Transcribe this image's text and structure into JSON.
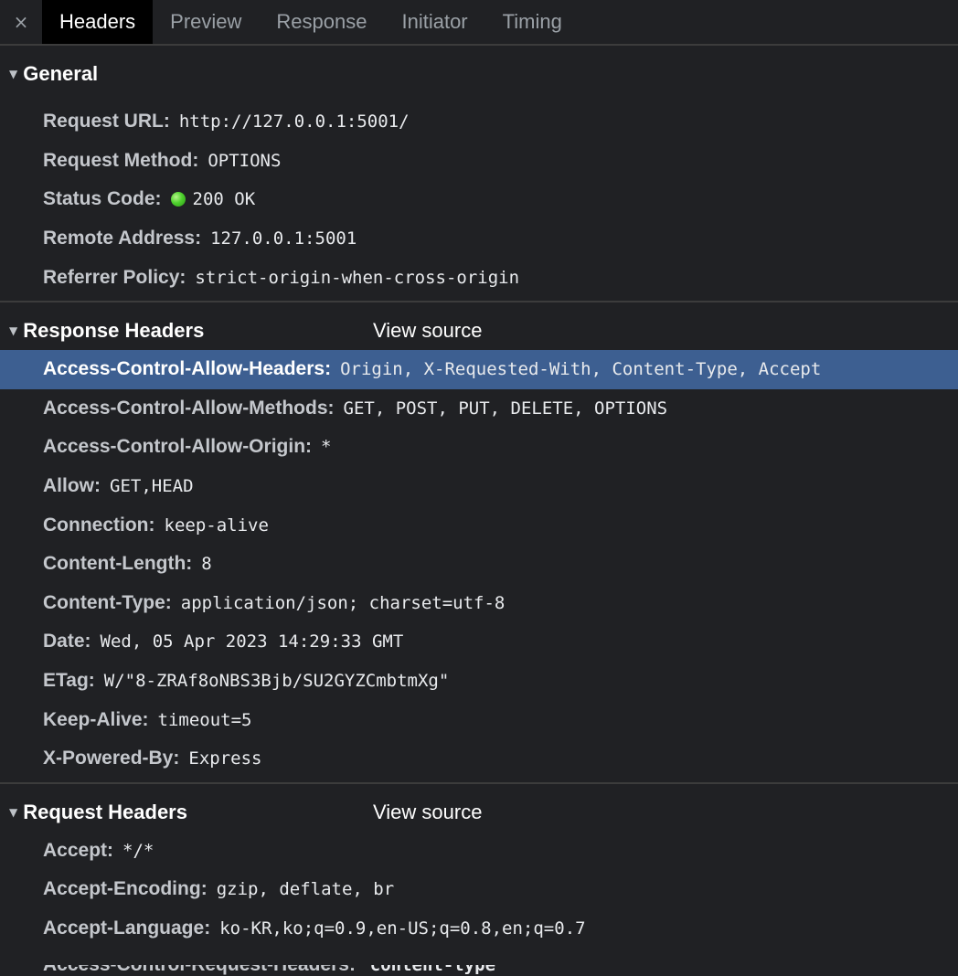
{
  "tabs": {
    "close_glyph": "×",
    "items": [
      "Headers",
      "Preview",
      "Response",
      "Initiator",
      "Timing"
    ],
    "active": "Headers"
  },
  "general": {
    "title": "General",
    "rows": [
      {
        "name": "Request URL",
        "value": "http://127.0.0.1:5001/"
      },
      {
        "name": "Request Method",
        "value": "OPTIONS"
      },
      {
        "name": "Status Code",
        "value": "200 OK",
        "status_color": "#4fd12e"
      },
      {
        "name": "Remote Address",
        "value": "127.0.0.1:5001"
      },
      {
        "name": "Referrer Policy",
        "value": "strict-origin-when-cross-origin"
      }
    ]
  },
  "response_headers": {
    "title": "Response Headers",
    "view_source": "View source",
    "rows": [
      {
        "name": "Access-Control-Allow-Headers",
        "value": "Origin, X-Requested-With, Content-Type, Accept",
        "selected": true
      },
      {
        "name": "Access-Control-Allow-Methods",
        "value": "GET, POST, PUT, DELETE, OPTIONS"
      },
      {
        "name": "Access-Control-Allow-Origin",
        "value": "*"
      },
      {
        "name": "Allow",
        "value": "GET,HEAD"
      },
      {
        "name": "Connection",
        "value": "keep-alive"
      },
      {
        "name": "Content-Length",
        "value": "8"
      },
      {
        "name": "Content-Type",
        "value": "application/json; charset=utf-8"
      },
      {
        "name": "Date",
        "value": "Wed, 05 Apr 2023 14:29:33 GMT"
      },
      {
        "name": "ETag",
        "value": "W/\"8-ZRAf8oNBS3Bjb/SU2GYZCmbtmXg\""
      },
      {
        "name": "Keep-Alive",
        "value": "timeout=5"
      },
      {
        "name": "X-Powered-By",
        "value": "Express"
      }
    ]
  },
  "request_headers": {
    "title": "Request Headers",
    "view_source": "View source",
    "rows": [
      {
        "name": "Accept",
        "value": "*/*"
      },
      {
        "name": "Accept-Encoding",
        "value": "gzip, deflate, br"
      },
      {
        "name": "Accept-Language",
        "value": "ko-KR,ko;q=0.9,en-US;q=0.8,en;q=0.7"
      }
    ],
    "cutoff_row": {
      "name": "Access-Control-Request-Headers",
      "value": "content-type"
    }
  },
  "colors": {
    "background": "#202124",
    "selected_row": "#3d5f91",
    "active_tab": "#000000"
  }
}
